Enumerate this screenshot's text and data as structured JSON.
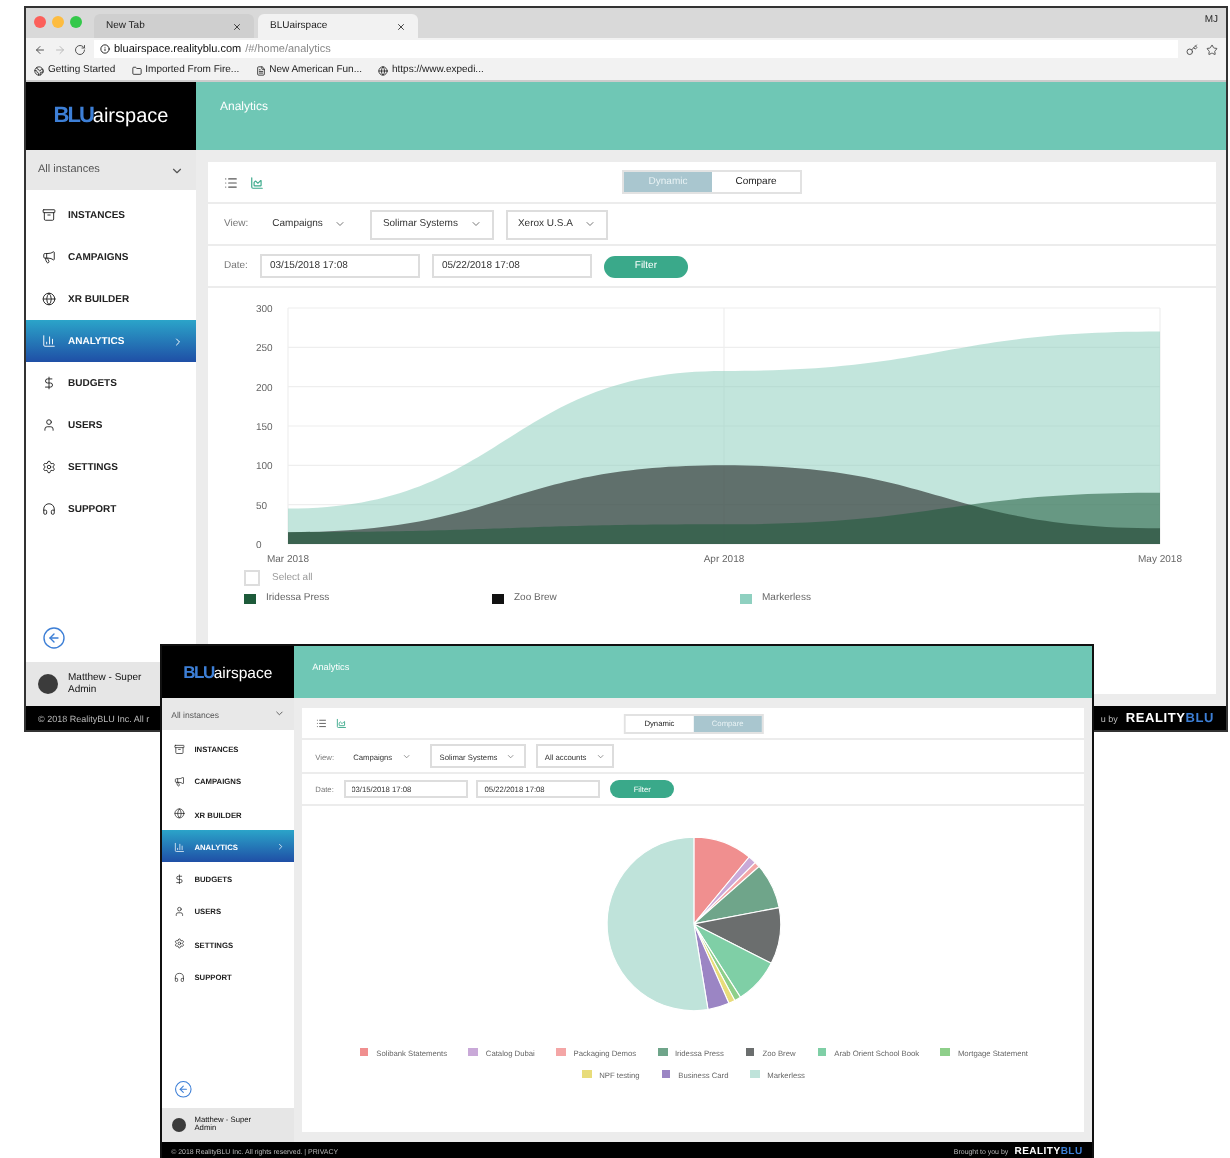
{
  "browser": {
    "tabs": [
      {
        "label": "New Tab",
        "selected": false
      },
      {
        "label": "BLUairspace",
        "selected": true
      }
    ],
    "profile": "MJ",
    "url_host": "bluairspace.realityblu.com",
    "url_path": "/#/home/analytics",
    "bookmarks": [
      "Getting Started",
      "Imported From Fire...",
      "New American Fun...",
      "https://www.expedi..."
    ]
  },
  "windows": [
    {
      "logo_mark": "BLU",
      "logo_text": "airspace",
      "title": "Analytics",
      "instance_select": "All instances",
      "nav": [
        {
          "label": "INSTANCES",
          "selected": false
        },
        {
          "label": "CAMPAIGNS",
          "selected": false
        },
        {
          "label": "XR BUILDER",
          "selected": false
        },
        {
          "label": "ANALYTICS",
          "selected": true
        },
        {
          "label": "BUDGETS",
          "selected": false
        },
        {
          "label": "USERS",
          "selected": false
        },
        {
          "label": "SETTINGS",
          "selected": false
        },
        {
          "label": "SUPPORT",
          "selected": false
        }
      ],
      "user": "Matthew - Super Admin",
      "modes": [
        {
          "label": "Dynamic",
          "selected": true
        },
        {
          "label": "Compare",
          "selected": false
        }
      ],
      "view_label": "View:",
      "filters": [
        "Campaigns",
        "Solimar Systems",
        "Xerox U.S.A"
      ],
      "date_label": "Date:",
      "dates": [
        "03/15/2018 17:08",
        "05/22/2018 17:08"
      ],
      "filter_button": "Filter",
      "card": {
        "kind": "area",
        "chart_data": {
          "type": "area",
          "categories": [
            "Mar 2018",
            "Apr 2018",
            "May 2018"
          ],
          "grid": true,
          "ylim": [
            0,
            300
          ],
          "yticks": [
            0,
            50,
            100,
            150,
            200,
            250,
            300
          ],
          "series": [
            {
              "name": "Iridessa Press",
              "color": "#1d5a3a",
              "values": [
                15,
                25,
                65
              ]
            },
            {
              "name": "Zoo Brew",
              "color": "#111111",
              "values": [
                15,
                100,
                20
              ]
            },
            {
              "name": "Markerless",
              "color": "#8fd0c0",
              "values": [
                45,
                220,
                270
              ]
            }
          ]
        },
        "select_all": {
          "label": "Select all",
          "checked": false
        }
      },
      "footer": {
        "left": "© 2018 RealityBLU Inc. All r",
        "right": "u by",
        "logo_a": "REALITY",
        "logo_b": "BLU"
      }
    },
    {
      "logo_mark": "BLU",
      "logo_text": "airspace",
      "title": "Analytics",
      "instance_select": "All instances",
      "nav": [
        {
          "label": "INSTANCES",
          "selected": false
        },
        {
          "label": "CAMPAIGNS",
          "selected": false
        },
        {
          "label": "XR BUILDER",
          "selected": false
        },
        {
          "label": "ANALYTICS",
          "selected": true
        },
        {
          "label": "BUDGETS",
          "selected": false
        },
        {
          "label": "USERS",
          "selected": false
        },
        {
          "label": "SETTINGS",
          "selected": false
        },
        {
          "label": "SUPPORT",
          "selected": false
        }
      ],
      "user": "Matthew - Super Admin",
      "modes": [
        {
          "label": "Dynamic",
          "selected": false
        },
        {
          "label": "Compare",
          "selected": true
        }
      ],
      "view_label": "View:",
      "filters": [
        "Campaigns",
        "Solimar Systems",
        "All accounts"
      ],
      "date_label": "Date:",
      "dates": [
        "03/15/2018 17:08",
        "05/22/2018 17:08"
      ],
      "filter_button": "Filter",
      "card": {
        "kind": "pie",
        "legend": [
          {
            "label": "Solibank Statements",
            "color": "#f08f8f"
          },
          {
            "label": "Catalog Dubai",
            "color": "#c9a9d8"
          },
          {
            "label": "Packaging Demos",
            "color": "#f4a6a6"
          },
          {
            "label": "Iridessa Press",
            "color": "#6fa58a"
          },
          {
            "label": "Zoo Brew",
            "color": "#6b6e6e"
          },
          {
            "label": "Arab Orient School Book",
            "color": "#7fcfa6"
          },
          {
            "label": "Mortgage Statement",
            "color": "#8ecf8a"
          },
          {
            "label": "NPF testing",
            "color": "#e8dc7a"
          },
          {
            "label": "Business Card",
            "color": "#9b85c4"
          },
          {
            "label": "Markerless",
            "color": "#bfe3da"
          }
        ]
      },
      "footer": {
        "left": "© 2018 RealityBLU Inc. All rights reserved. | PRIVACY",
        "right": "Brought to you by",
        "logo_a": "REALITY",
        "logo_b": "BLU"
      }
    }
  ]
}
